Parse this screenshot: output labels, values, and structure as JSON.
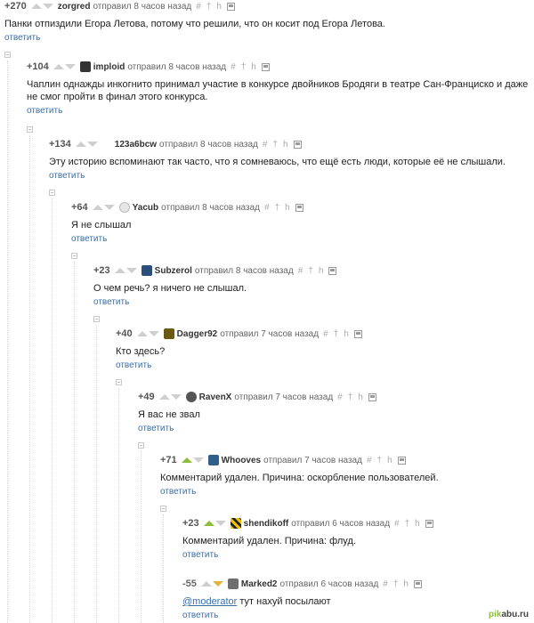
{
  "reply_label": "ответить",
  "watermark": {
    "prefix": "pik",
    "suffix": "abu.ru",
    "accent": "#8bbd3a"
  },
  "comments": [
    {
      "rating": "+270",
      "author": "zorgred",
      "meta": "отправил 8 часов назад",
      "text": "Панки отпиздили Егора Летова, потому что решили, что он косит под Егора Летова."
    },
    {
      "rating": "+104",
      "author": "imploid",
      "meta": "отправил 8 часов назад",
      "text": "Чаплин однажды инкогнито принимал участие в конкурсе двойников Бродяги в театре Сан-Франциско и даже не смог пройти в финал этого конкурса."
    },
    {
      "rating": "+134",
      "author": "123a6bcw",
      "meta": "отправил 8 часов назад",
      "text": "Эту историю вспоминают так часто, что я сомневаюсь, что ещё есть люди, которые её не слышали."
    },
    {
      "rating": "+64",
      "author": "Yacub",
      "meta": "отправил 8 часов назад",
      "text": "Я не слышал"
    },
    {
      "rating": "+23",
      "author": "Subzerol",
      "meta": "отправил 8 часов назад",
      "text": "О чем речь? я ничего не слышал."
    },
    {
      "rating": "+40",
      "author": "Dagger92",
      "meta": "отправил 7 часов назад",
      "text": "Кто здесь?"
    },
    {
      "rating": "+49",
      "author": "RavenX",
      "meta": "отправил 7 часов назад",
      "text": "Я вас не звал"
    },
    {
      "rating": "+71",
      "author": "Whooves",
      "meta": "отправил 7 часов назад",
      "text": "Комментарий удален. Причина: оскорбление пользователей."
    },
    {
      "rating": "+23",
      "author": "shendikoff",
      "meta": "отправил 6 часов назад",
      "text": "Комментарий удален. Причина: флуд."
    },
    {
      "rating": "-55",
      "author": "Marked2",
      "meta": "отправил 6 часов назад",
      "mention": "@moderator",
      "text": " тут нахуй посылают"
    }
  ],
  "tools": {
    "hash": "#",
    "cross": "†",
    "reply_arrow": "h"
  },
  "colors": {
    "link": "#3a6ea5",
    "upvote_active": "#8bbd3a",
    "downvote_active": "#e2b33a"
  }
}
